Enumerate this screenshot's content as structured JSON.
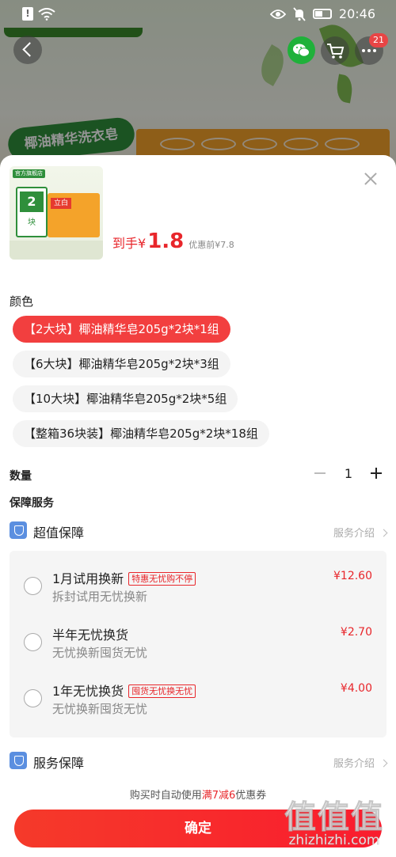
{
  "status_bar": {
    "time": "20:46",
    "alert_icon_text": "!"
  },
  "nav": {
    "cart_badge": "21"
  },
  "background": {
    "banner_text": "椰油精华洗衣皂"
  },
  "sheet": {
    "thumbnail": {
      "store_badge": "官方旗舰店",
      "pack_count": "2",
      "pack_unit": "块",
      "brand_label": "立白"
    },
    "price": {
      "label": "到手",
      "symbol": "¥",
      "value": "1.8",
      "original": "优惠前¥7.8"
    },
    "color_section": {
      "title": "颜色",
      "options": [
        {
          "label": "【2大块】椰油精华皂205g*2块*1组",
          "selected": true
        },
        {
          "label": "【6大块】椰油精华皂205g*2块*3组",
          "selected": false
        },
        {
          "label": "【10大块】椰油精华皂205g*2块*5组",
          "selected": false
        },
        {
          "label": "【整箱36块装】椰油精华皂205g*2块*18组",
          "selected": false
        }
      ]
    },
    "quantity": {
      "title": "数量",
      "value": "1"
    },
    "services": {
      "title": "保障服务",
      "value_guard": {
        "title": "超值保障",
        "link": "服务介绍"
      },
      "plans": [
        {
          "name": "1月试用换新",
          "tag": "特惠无忧购不停",
          "desc": "拆封试用无忧换新",
          "price": "¥12.60"
        },
        {
          "name": "半年无忧换货",
          "tag": "",
          "desc": "无忧换新囤货无忧",
          "price": "¥2.70"
        },
        {
          "name": "1年无忧换货",
          "tag": "囤货无忧换无忧",
          "desc": "无忧换新囤货无忧",
          "price": "¥4.00"
        }
      ],
      "service_guard": {
        "title": "服务保障",
        "link": "服务介绍"
      }
    },
    "coupon": {
      "prefix": "购买时自动使用",
      "highlight": "满7减6",
      "suffix": "优惠券"
    },
    "confirm_label": "确定"
  },
  "watermark": {
    "glyph": "值值值",
    "text": "zhizhizhi.com"
  },
  "colors": {
    "accent": "#f23f3f",
    "price_red": "#e8262b",
    "shield_blue": "#5b8fe0"
  }
}
